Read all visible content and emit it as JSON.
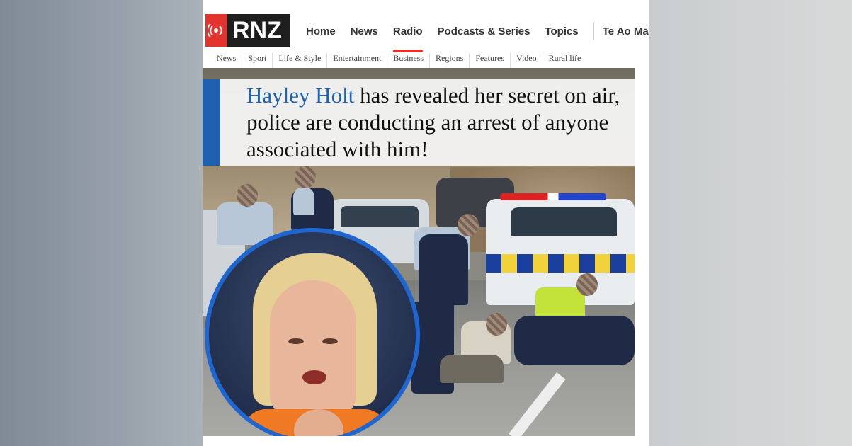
{
  "brand": {
    "logo_text": "RNZ",
    "accent": "#e2342c"
  },
  "main_nav": {
    "items": [
      {
        "label": "Home",
        "active": false
      },
      {
        "label": "News",
        "active": false
      },
      {
        "label": "Radio",
        "active": true
      },
      {
        "label": "Podcasts & Series",
        "active": false
      },
      {
        "label": "Topics",
        "active": false
      },
      {
        "label": "Te Ao Māori",
        "active": false
      }
    ]
  },
  "sub_nav": {
    "items": [
      "News",
      "Sport",
      "Life & Style",
      "Entertainment",
      "Business",
      "Regions",
      "Features",
      "Video",
      "Rural life"
    ]
  },
  "article": {
    "headline_name": "Hayley Holt",
    "headline_rest": " has revealed her secret on air, police are conducting an arrest of anyone associated with him!",
    "name_color": "#1d63b3"
  }
}
